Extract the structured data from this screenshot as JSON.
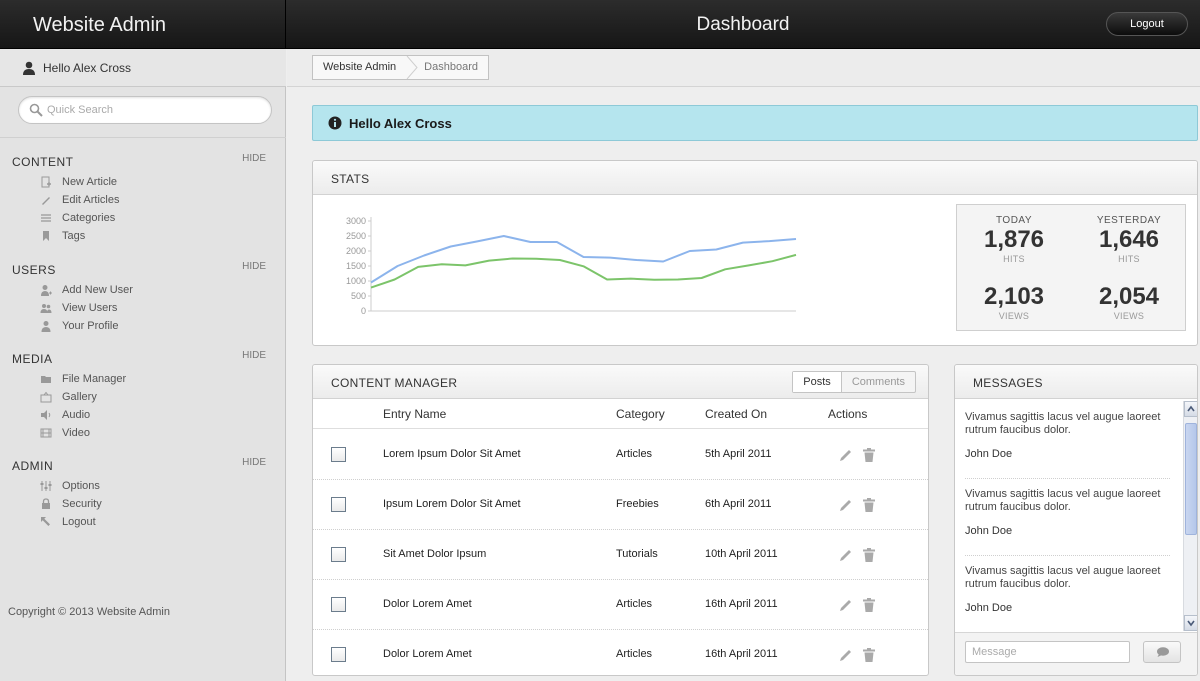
{
  "header": {
    "brand": "Website Admin",
    "title": "Dashboard",
    "logout_label": "Logout"
  },
  "sidebar": {
    "greeting": "Hello Alex Cross",
    "search_placeholder": "Quick Search",
    "sections": [
      {
        "title": "CONTENT",
        "hide_label": "HIDE",
        "items": [
          {
            "label": "New Article",
            "icon": "new-article-icon"
          },
          {
            "label": "Edit Articles",
            "icon": "pencil-icon"
          },
          {
            "label": "Categories",
            "icon": "list-icon"
          },
          {
            "label": "Tags",
            "icon": "tag-icon"
          }
        ]
      },
      {
        "title": "USERS",
        "hide_label": "HIDE",
        "items": [
          {
            "label": "Add New User",
            "icon": "add-user-icon"
          },
          {
            "label": "View Users",
            "icon": "users-icon"
          },
          {
            "label": "Your Profile",
            "icon": "user-icon"
          }
        ]
      },
      {
        "title": "MEDIA",
        "hide_label": "HIDE",
        "items": [
          {
            "label": "File Manager",
            "icon": "folder-icon"
          },
          {
            "label": "Gallery",
            "icon": "gallery-icon"
          },
          {
            "label": "Audio",
            "icon": "speaker-icon"
          },
          {
            "label": "Video",
            "icon": "film-icon"
          }
        ]
      },
      {
        "title": "ADMIN",
        "hide_label": "HIDE",
        "items": [
          {
            "label": "Options",
            "icon": "sliders-icon"
          },
          {
            "label": "Security",
            "icon": "lock-icon"
          },
          {
            "label": "Logout",
            "icon": "logout-arrow-icon"
          }
        ]
      }
    ],
    "copyright": "Copyright © 2013 Website Admin"
  },
  "breadcrumb": [
    "Website Admin",
    "Dashboard"
  ],
  "alert": {
    "text": "Hello Alex Cross",
    "icon": "info-icon"
  },
  "stats": {
    "title": "STATS",
    "today_label": "TODAY",
    "yesterday_label": "YESTERDAY",
    "today": {
      "hits": "1,876",
      "hits_label": "HITS",
      "views": "2,103",
      "views_label": "VIEWS"
    },
    "yesterday": {
      "hits": "1,646",
      "hits_label": "HITS",
      "views": "2,054",
      "views_label": "VIEWS"
    }
  },
  "chart_data": {
    "type": "line",
    "y_ticks": [
      0,
      500,
      1000,
      1500,
      2000,
      2500,
      3000
    ],
    "ylim": [
      0,
      3000
    ],
    "grid": false,
    "legend": "none",
    "series": [
      {
        "color": "#8cb4ec",
        "values": [
          950,
          1500,
          1850,
          2150,
          2320,
          2500,
          2300,
          2300,
          1800,
          1780,
          1700,
          1650,
          2000,
          2050,
          2280,
          2330,
          2400
        ]
      },
      {
        "color": "#7cc46a",
        "values": [
          780,
          1050,
          1470,
          1560,
          1520,
          1680,
          1750,
          1740,
          1700,
          1490,
          1050,
          1080,
          1040,
          1050,
          1100,
          1390,
          1520,
          1660,
          1870
        ]
      }
    ]
  },
  "content_manager": {
    "title": "CONTENT MANAGER",
    "tabs": [
      "Posts",
      "Comments"
    ],
    "columns": [
      "Entry Name",
      "Category",
      "Created On",
      "Actions"
    ],
    "rows": [
      {
        "name": "Lorem Ipsum Dolor Sit Amet",
        "category": "Articles",
        "created": "5th April 2011"
      },
      {
        "name": "Ipsum Lorem Dolor Sit Amet",
        "category": "Freebies",
        "created": "6th April 2011"
      },
      {
        "name": "Sit Amet Dolor Ipsum",
        "category": "Tutorials",
        "created": "10th April 2011"
      },
      {
        "name": "Dolor Lorem Amet",
        "category": "Articles",
        "created": "16th April 2011"
      },
      {
        "name": "Dolor Lorem Amet",
        "category": "Articles",
        "created": "16th April 2011"
      }
    ]
  },
  "messages": {
    "title": "MESSAGES",
    "items": [
      {
        "text": "Vivamus sagittis lacus vel augue laoreet rutrum faucibus dolor.",
        "author": "John Doe"
      },
      {
        "text": "Vivamus sagittis lacus vel augue laoreet rutrum faucibus dolor.",
        "author": "John Doe"
      },
      {
        "text": "Vivamus sagittis lacus vel augue laoreet rutrum faucibus dolor.",
        "author": "John Doe"
      }
    ],
    "input_placeholder": "Message"
  },
  "colors": {
    "alert_bg": "#b5e5ee",
    "topbar_bg": "#1e1e1e",
    "line_hits": "#8cb4ec",
    "line_views": "#7cc46a"
  }
}
